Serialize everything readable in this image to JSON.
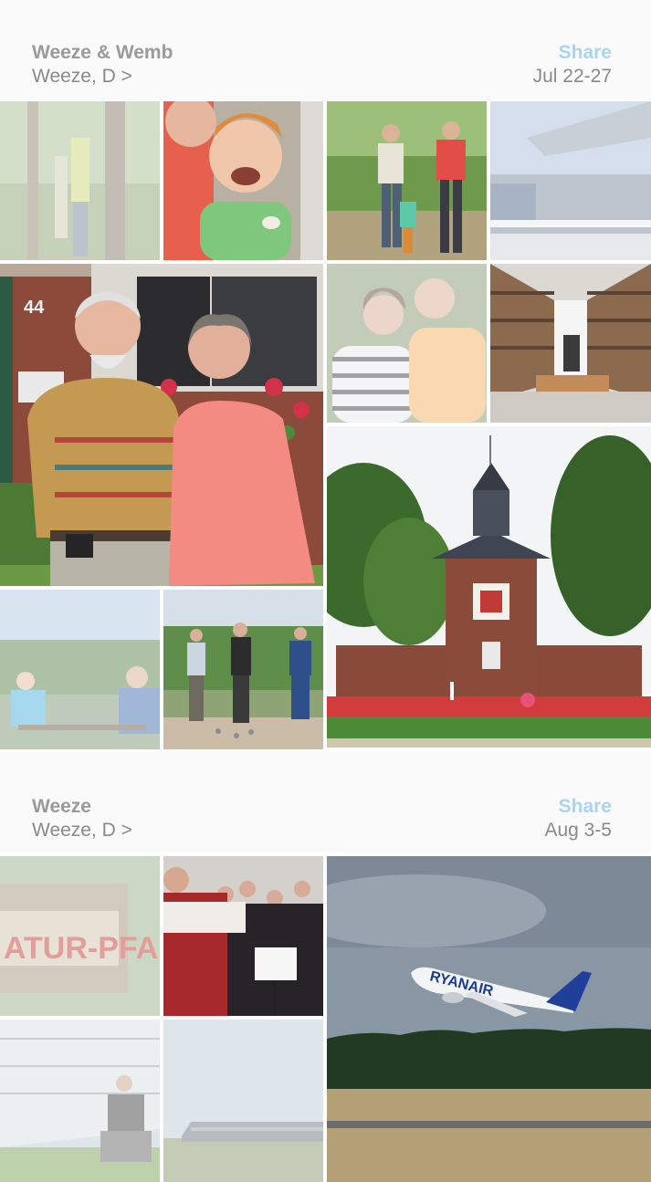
{
  "moments": [
    {
      "title": "Weeze & Wemb",
      "location": "Weeze, D >",
      "share_label": "Share",
      "dates": "Jul 22-27"
    },
    {
      "title": "Weeze",
      "location": "Weeze, D >",
      "share_label": "Share",
      "dates": "Aug 3-5"
    }
  ],
  "photo_text": {
    "sign_text": "ATUR-PFAD",
    "airline_text": "RYANAIR"
  }
}
